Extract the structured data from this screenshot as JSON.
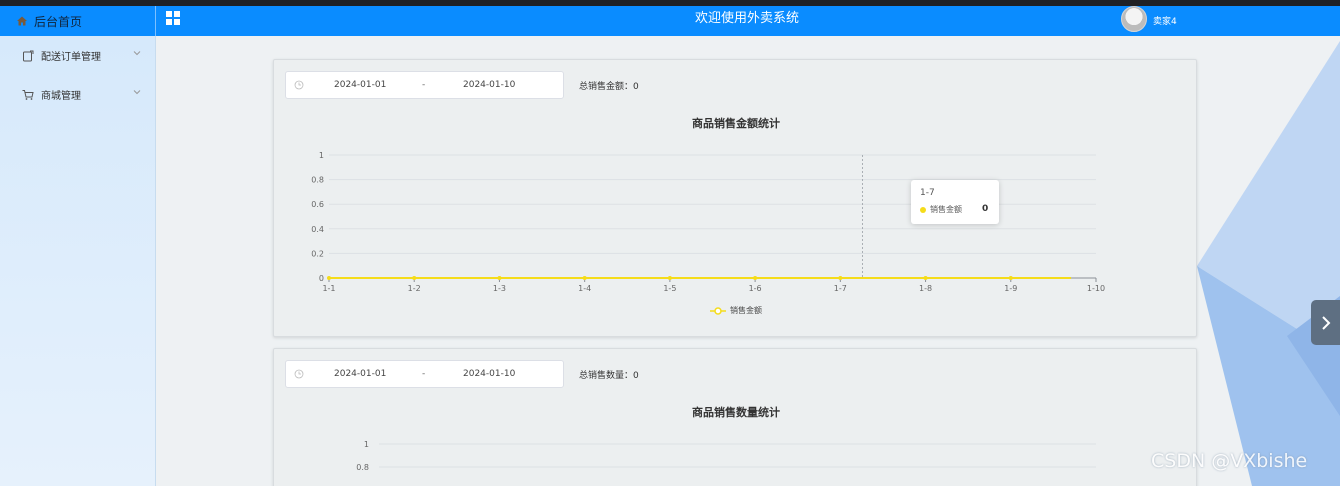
{
  "header": {
    "home_label": "后台首页",
    "title": "欢迎使用外卖系统",
    "username": "卖家4",
    "brand_color": "#0a8cff"
  },
  "sidebar": {
    "items": [
      {
        "label": "配送订单管理",
        "icon": "order-icon"
      },
      {
        "label": "商城管理",
        "icon": "cart-icon"
      }
    ]
  },
  "sales_amount": {
    "date_start": "2024-01-01",
    "date_sep": "-",
    "date_end": "2024-01-10",
    "total_label": "总销售金额：",
    "total_value": "0",
    "tooltip": {
      "x": "1-7",
      "name": "销售金额",
      "value": "0"
    }
  },
  "sales_count": {
    "date_start": "2024-01-01",
    "date_sep": "-",
    "date_end": "2024-01-10",
    "total_label": "总销售数量：",
    "total_value": "0"
  },
  "chart_data": [
    {
      "type": "line",
      "title": "商品销售金额统计",
      "categories": [
        "1-1",
        "1-2",
        "1-3",
        "1-4",
        "1-5",
        "1-6",
        "1-7",
        "1-8",
        "1-9",
        "1-10"
      ],
      "series": [
        {
          "name": "销售金额",
          "values": [
            0,
            0,
            0,
            0,
            0,
            0,
            0,
            0,
            0,
            0
          ],
          "color": "#f5dc1a"
        }
      ],
      "yticks": [
        "0",
        "0.2",
        "0.4",
        "0.6",
        "0.8",
        "1"
      ],
      "ylim": [
        0,
        1
      ],
      "grid": true,
      "legend": "bottom-center"
    },
    {
      "type": "line",
      "title": "商品销售数量统计",
      "yticks": [
        "0.8",
        "1"
      ],
      "ylim": [
        0,
        1
      ],
      "grid": true
    }
  ],
  "watermark": "CSDN @VXbishe"
}
